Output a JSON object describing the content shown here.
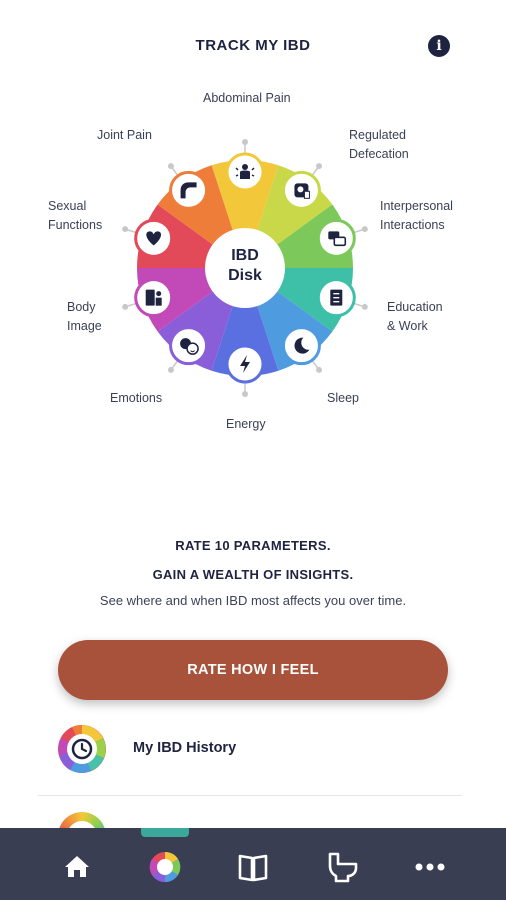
{
  "header": {
    "title": "TRACK MY IBD",
    "info_icon": "info-icon"
  },
  "disk": {
    "center_line1": "IBD",
    "center_line2": "Disk",
    "segments": [
      {
        "id": "abdominal-pain",
        "label": "Abdominal Pain",
        "icon": "abdominal-pain-icon",
        "color": "#f2c83a"
      },
      {
        "id": "regulated-defecation",
        "label": "Regulated Defecation",
        "icon": "toilet-roll-icon",
        "color": "#c8d848"
      },
      {
        "id": "interpersonal",
        "label": "Interpersonal Interactions",
        "icon": "chat-bubbles-icon",
        "color": "#7cc85a"
      },
      {
        "id": "education-work",
        "label": "Education & Work",
        "icon": "document-icon",
        "color": "#3ec0a8"
      },
      {
        "id": "sleep",
        "label": "Sleep",
        "icon": "moon-icon",
        "color": "#4f9be0"
      },
      {
        "id": "energy",
        "label": "Energy",
        "icon": "lightning-icon",
        "color": "#5a6fe0"
      },
      {
        "id": "emotions",
        "label": "Emotions",
        "icon": "emotions-icon",
        "color": "#8a5ed8"
      },
      {
        "id": "body-image",
        "label": "Body Image",
        "icon": "mirror-icon",
        "color": "#c249b8"
      },
      {
        "id": "sexual-functions",
        "label": "Sexual Functions",
        "icon": "heart-icon",
        "color": "#e24a5a"
      },
      {
        "id": "joint-pain",
        "label": "Joint Pain",
        "icon": "joint-icon",
        "color": "#ef7d3a"
      }
    ]
  },
  "labels": {
    "abdominal": "Abdominal Pain",
    "regulated1": "Regulated",
    "regulated2": "Defecation",
    "interpersonal1": "Interpersonal",
    "interpersonal2": "Interactions",
    "education1": "Education",
    "education2": "& Work",
    "sleep": "Sleep",
    "energy": "Energy",
    "emotions": "Emotions",
    "body1": "Body",
    "body2": "Image",
    "sexual1": "Sexual",
    "sexual2": "Functions",
    "joint": "Joint Pain"
  },
  "intro": {
    "line1": "RATE 10 PARAMETERS.",
    "line2": "GAIN A WEALTH OF INSIGHTS.",
    "line3": "See where and when IBD most affects you over time."
  },
  "cta": {
    "label": "RATE HOW I FEEL"
  },
  "history": {
    "label": "My IBD History",
    "icon": "clock-icon"
  },
  "tabbar": {
    "active": "disk",
    "tabs": [
      {
        "id": "home",
        "icon": "home-icon"
      },
      {
        "id": "disk",
        "icon": "disk-icon"
      },
      {
        "id": "learn",
        "icon": "book-icon"
      },
      {
        "id": "toilet",
        "icon": "toilet-icon"
      },
      {
        "id": "more",
        "icon": "more-icon"
      }
    ]
  },
  "colors": {
    "primary": "#1e2340",
    "accent": "#a8523c",
    "tabbar": "#393e53",
    "tab_indicator": "#3aa89a"
  }
}
